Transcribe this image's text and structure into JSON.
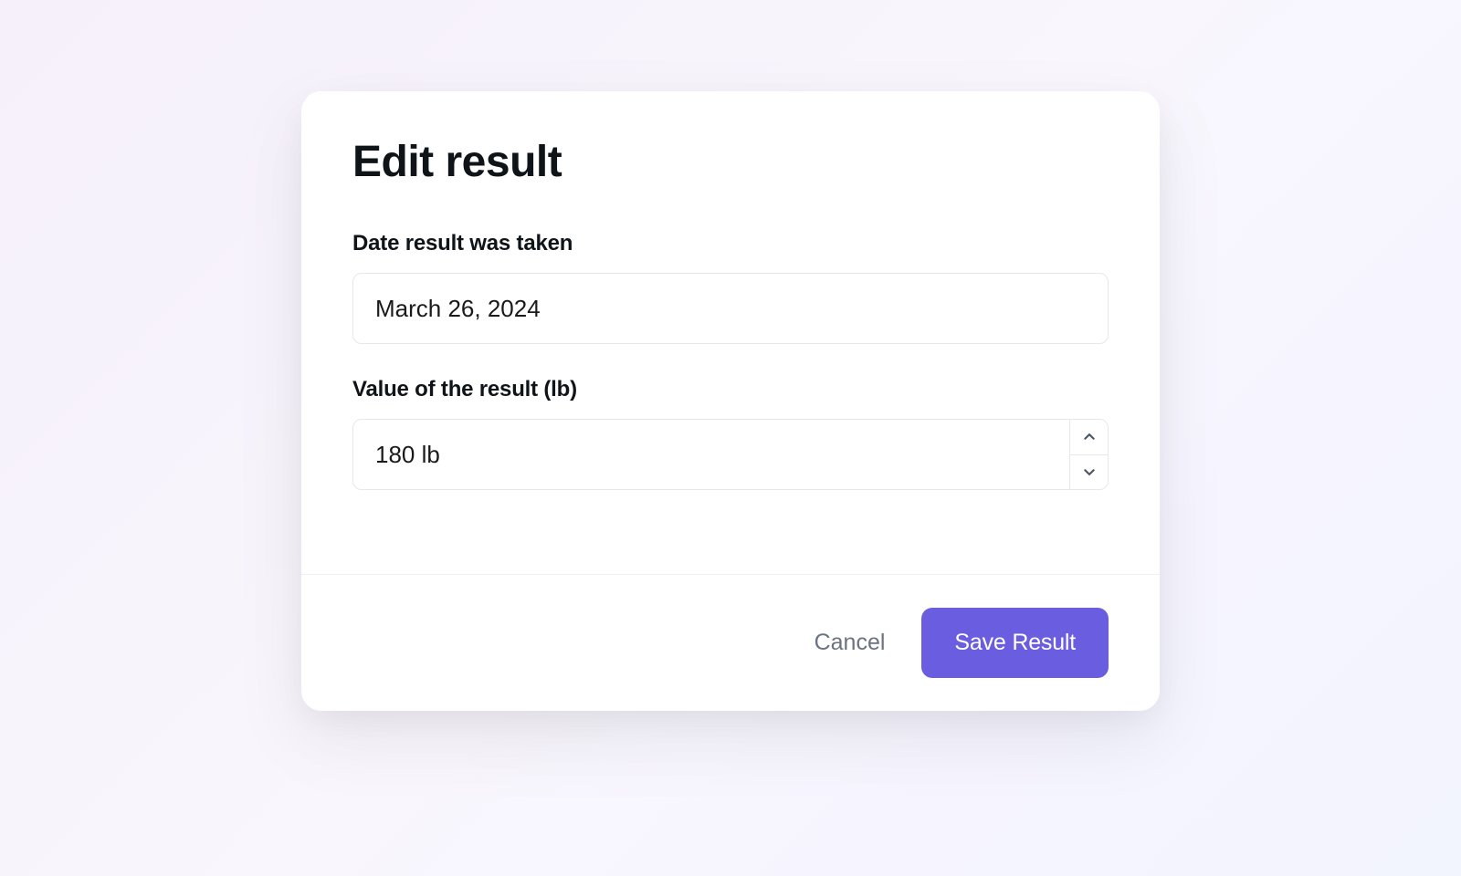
{
  "modal": {
    "title": "Edit result",
    "fields": {
      "date": {
        "label": "Date result was taken",
        "value": "March 26, 2024"
      },
      "value": {
        "label": "Value of the result (lb)",
        "value": "180 lb"
      }
    },
    "actions": {
      "cancel": "Cancel",
      "save": "Save Result"
    }
  },
  "colors": {
    "primary": "#6a5de0"
  }
}
